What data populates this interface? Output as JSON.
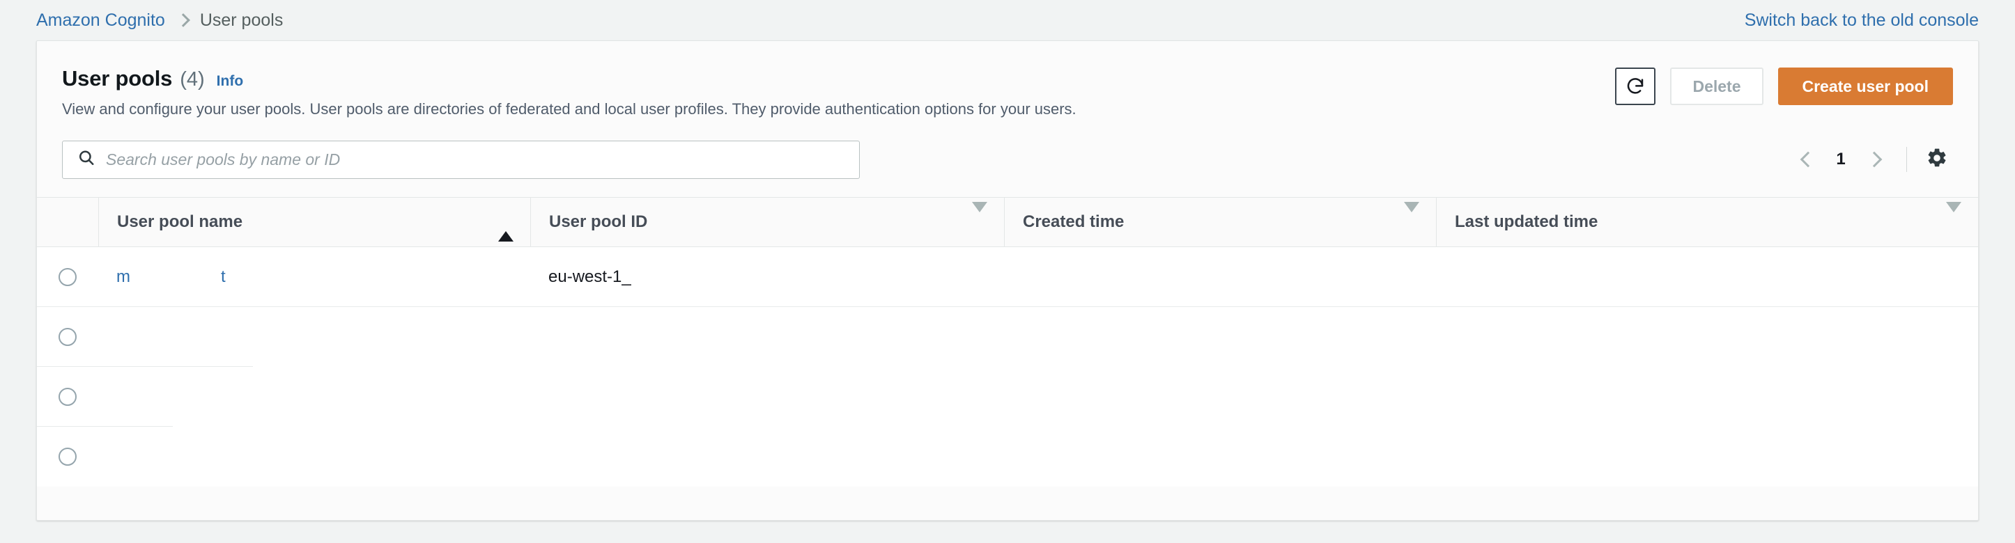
{
  "breadcrumb": {
    "service_link": "Amazon Cognito",
    "separator_icon": "chevron-right-icon",
    "current": "User pools"
  },
  "header": {
    "switch_console_link": "Switch back to the old console"
  },
  "panel": {
    "title": "User pools",
    "count": "(4)",
    "info_link": "Info",
    "description": "View and configure your user pools. User pools are directories of federated and local user profiles. They provide authentication options for your users.",
    "actions": {
      "refresh_icon": "refresh-icon",
      "refresh_label": "",
      "delete_label": "Delete",
      "delete_disabled": true,
      "create_label": "Create user pool",
      "primary_color": "#d97b33"
    }
  },
  "search": {
    "icon": "search-icon",
    "placeholder": "Search user pools by name or ID",
    "value": ""
  },
  "pagination": {
    "prev_icon": "chevron-left-icon",
    "prev_disabled": true,
    "page": "1",
    "next_icon": "chevron-right-icon",
    "next_disabled": true,
    "settings_icon": "gear-icon"
  },
  "table": {
    "select_column_header": "",
    "columns": [
      {
        "label": "User pool name",
        "sort_icon": "sort-ascending-icon",
        "sorted": true
      },
      {
        "label": "User pool ID",
        "sort_icon": "sort-descending-icon",
        "sorted": false
      },
      {
        "label": "Created time",
        "sort_icon": "sort-descending-icon",
        "sorted": false
      },
      {
        "label": "Last updated time",
        "sort_icon": "sort-descending-icon",
        "sorted": false
      }
    ],
    "rows": [
      {
        "name_fragment_a": "m",
        "name_fragment_b": "t",
        "pool_id": "eu-west-1_",
        "created_time": "",
        "last_updated_time": ""
      },
      {
        "name_fragment_a": "",
        "name_fragment_b": "",
        "pool_id": "",
        "created_time": "",
        "last_updated_time": ""
      },
      {
        "name_fragment_a": "",
        "name_fragment_b": "",
        "pool_id": "",
        "created_time": "",
        "last_updated_time": ""
      },
      {
        "name_fragment_a": "",
        "name_fragment_b": "",
        "pool_id": "",
        "created_time": "",
        "last_updated_time": ""
      }
    ]
  }
}
